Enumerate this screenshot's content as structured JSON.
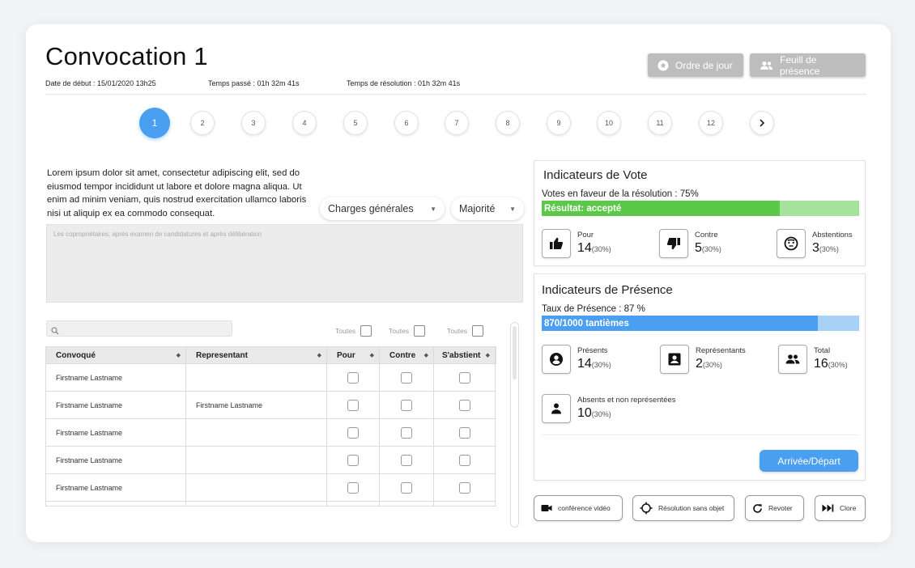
{
  "header": {
    "title": "Convocation 1",
    "date_debut": "Date de début : 15/01/2020 13h25",
    "temps_passe": "Temps passé : 01h 32m 41s",
    "temps_resolution": "Temps de résolution : 01h 32m 41s",
    "ordre_du_jour": "Ordre de jour",
    "feuille_presence": "Feuill de présence"
  },
  "steps": [
    "1",
    "2",
    "3",
    "4",
    "5",
    "6",
    "7",
    "8",
    "9",
    "10",
    "11",
    "12"
  ],
  "steps_active": "1",
  "resolution": {
    "text": "Lorem ipsum dolor sit amet, consectetur adipiscing elit, sed do eiusmod tempor incididunt ut labore et dolore magna aliqua. Ut enim ad minim veniam, quis nostrud exercitation ullamco laboris nisi ut aliquip ex ea commodo consequat.",
    "charges_select": "Charges générales",
    "majorite_select": "Majorité",
    "textarea_placeholder": "Les copropriétaires, après examen de candidatures et après délibération"
  },
  "table": {
    "toutes_label": "Toutes",
    "headers": [
      "Convoqué",
      "Representant",
      "Pour",
      "Contre",
      "S'abstient"
    ],
    "rows": [
      {
        "convoque": "Firstname Lastname",
        "representant": ""
      },
      {
        "convoque": "Firstname Lastname",
        "representant": "Firstname Lastname"
      },
      {
        "convoque": "Firstname Lastname",
        "representant": ""
      },
      {
        "convoque": "Firstname Lastname",
        "representant": ""
      },
      {
        "convoque": "Firstname Lastname",
        "representant": ""
      }
    ]
  },
  "vote": {
    "title": "Indicateurs de Vote",
    "subtitle": "Votes en faveur de la résolution : 75%",
    "percent": 75,
    "bar_label": "Résultat: accepté",
    "pour_label": "Pour",
    "pour_value": "14",
    "pour_pct": "(30%)",
    "contre_label": "Contre",
    "contre_value": "5",
    "contre_pct": "(30%)",
    "abst_label": "Abstentions",
    "abst_value": "3",
    "abst_pct": "(30%)"
  },
  "presence": {
    "title": "Indicateurs de Présence",
    "subtitle": "Taux de Présence : 87 %",
    "percent": 87,
    "bar_label": "870/1000 tantièmes",
    "presents_label": "Présents",
    "presents_value": "14",
    "presents_pct": "(30%)",
    "repr_label": "Représentants",
    "repr_value": "2",
    "repr_pct": "(30%)",
    "total_label": "Total",
    "total_value": "16",
    "total_pct": "(30%)",
    "absents_label": "Absents et non représentées",
    "absents_value": "10",
    "absents_pct": "(30%)",
    "arrivee_button": "Arrivée/Départ"
  },
  "actions": {
    "video": "conférence vidéo",
    "sans_objet": "Résolution sans objet",
    "revoter": "Revoter",
    "clore": "Clore"
  },
  "colors": {
    "accent_blue": "#4a9ff0",
    "vote_green": "#5bc84a",
    "vote_green_light": "#a5e39c",
    "presence_blue": "#4a9ff0",
    "presence_blue_light": "#a9d1f7"
  }
}
